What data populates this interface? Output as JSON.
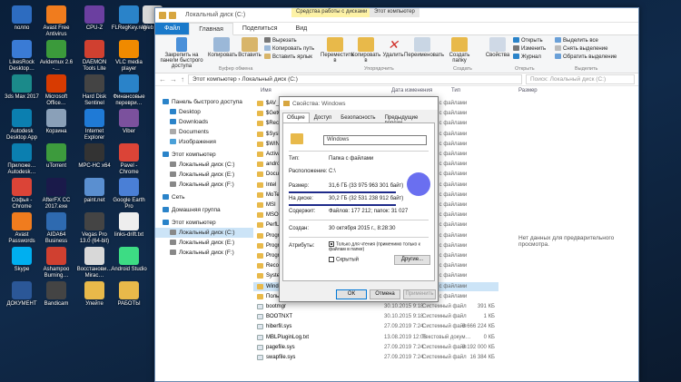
{
  "desktop_icons": [
    {
      "label": "nолпо",
      "color": "#2d6cc0"
    },
    {
      "label": "Avast Free Antivirus",
      "color": "#f07c1e"
    },
    {
      "label": "CPU-Z",
      "color": "#6b3fa0"
    },
    {
      "label": "FLRegKey.reg",
      "color": "#2a83c9"
    },
    {
      "label": "Web Ma",
      "color": "#d9d9d9"
    },
    {
      "label": "LikesRock Desktop…",
      "color": "#3a7bd5"
    },
    {
      "label": "Avidemux 2.6 -…",
      "color": "#3b9a3b"
    },
    {
      "label": "DAEMON Tools Lite",
      "color": "#d04030"
    },
    {
      "label": "VLC media player",
      "color": "#f08a00"
    },
    {
      "label": "3ds Max 2017",
      "color": "#1b8a8a"
    },
    {
      "label": "Microsoft Office…",
      "color": "#d83b01"
    },
    {
      "label": "Hard Disk Sentinel",
      "color": "#444"
    },
    {
      "label": "Финансовые переври…",
      "color": "#2a83c9"
    },
    {
      "label": "Autodesk Desktop App",
      "color": "#0b7fb0"
    },
    {
      "label": "Корзина",
      "color": "#8aa0b8"
    },
    {
      "label": "Internet Explorer",
      "color": "#1f7ad6"
    },
    {
      "label": "Viber",
      "color": "#7b519d"
    },
    {
      "label": "Приложе… Autodesk…",
      "color": "#0b7fb0"
    },
    {
      "label": "uTorrent",
      "color": "#3d9b3d"
    },
    {
      "label": "MPC-HC x64",
      "color": "#333"
    },
    {
      "label": "Pavel - Chrome",
      "color": "#db4437"
    },
    {
      "label": "Софья - Chrome",
      "color": "#db4437"
    },
    {
      "label": "AfterFX CC 2017.exe",
      "color": "#1a1a4a"
    },
    {
      "label": "paint.net",
      "color": "#5a8fd0"
    },
    {
      "label": "Google Earth Pro",
      "color": "#4a7fd6"
    },
    {
      "label": "Avast Passwords",
      "color": "#f07c1e"
    },
    {
      "label": "AIDA64 Business",
      "color": "#2e6ab0"
    },
    {
      "label": "Vegas Pro 13.0 (64-bit)",
      "color": "#444"
    },
    {
      "label": "links-drift.txt",
      "color": "#eee"
    },
    {
      "label": "Skype",
      "color": "#00aff0"
    },
    {
      "label": "Ashampoo Burning…",
      "color": "#d04030"
    },
    {
      "label": "Восстанови… Mirac…",
      "color": "#d8d8d8"
    },
    {
      "label": "Android Studio",
      "color": "#3ddc84"
    },
    {
      "label": "ДОКУМЕНТ",
      "color": "#2b5797"
    },
    {
      "label": "Bandicam",
      "color": "#444"
    },
    {
      "label": "Улейте",
      "color": "#e8b94a"
    },
    {
      "label": "РАБОТЫ",
      "color": "#e8b94a"
    }
  ],
  "explorer": {
    "title": "Локальный диск (C:)",
    "context_tabs": [
      "Средства работы с дисками",
      "Этот компьютер"
    ],
    "ribbon_tabs": [
      "Файл",
      "Главная",
      "Поделиться",
      "Вид"
    ],
    "ribbon": {
      "pin_label": "Закрепить на панели быстрого доступа",
      "copy_label": "Копировать",
      "paste_label": "Вставить",
      "cut_label": "Вырезать",
      "copy_path_label": "Копировать путь",
      "paste_shortcut_label": "Вставить ярлык",
      "clipboard_group": "Буфер обмена",
      "move_to_label": "Переместить в",
      "copy_to_label": "Копировать в",
      "delete_label": "Удалить",
      "rename_label": "Переименовать",
      "organize_group": "Упорядочить",
      "new_folder_label": "Создать папку",
      "create_group": "Создать",
      "properties_label": "Свойства",
      "open_label": "Открыть",
      "edit_label": "Изменить",
      "journal_label": "Журнал",
      "open_group": "Открыть",
      "select_all_label": "Выделить все",
      "select_none_label": "Снять выделение",
      "invert_label": "Обратить выделение",
      "select_group": "Выделить"
    },
    "address": {
      "path": "Этот компьютер  ›  Локальный диск (C:)",
      "search_placeholder": "Поиск: Локальный диск (C:)"
    },
    "columns": {
      "name": "Имя",
      "date": "Дата изменения",
      "type": "Тип",
      "size": "Размер"
    },
    "nav": [
      {
        "label": "Панель быстрого доступа",
        "color": "#2a83c9",
        "indent": 0
      },
      {
        "label": "Desktop",
        "color": "#2a83c9",
        "indent": 1
      },
      {
        "label": "Downloads",
        "color": "#2a83c9",
        "indent": 1
      },
      {
        "label": "Documents",
        "color": "#aaa",
        "indent": 1
      },
      {
        "label": "Изображения",
        "color": "#4aa0d8",
        "indent": 1
      },
      {
        "label": "Этот компьютер",
        "color": "#2a83c9",
        "indent": 0
      },
      {
        "label": "Локальный диск (C:)",
        "color": "#888",
        "indent": 1
      },
      {
        "label": "Локальный диск (E:)",
        "color": "#888",
        "indent": 1
      },
      {
        "label": "Локальный диск (F:)",
        "color": "#888",
        "indent": 1
      },
      {
        "label": "Сеть",
        "color": "#2a83c9",
        "indent": 0
      },
      {
        "label": "Домашняя группа",
        "color": "#2a83c9",
        "indent": 0
      },
      {
        "label": "Этот компьютер",
        "color": "#2a83c9",
        "indent": 0
      },
      {
        "label": "Локальный диск (C:)",
        "color": "#888",
        "indent": 1,
        "selected": true
      },
      {
        "label": "Локальный диск (E:)",
        "color": "#888",
        "indent": 1
      },
      {
        "label": "Локальный диск (F:)",
        "color": "#888",
        "indent": 1
      }
    ],
    "files": [
      {
        "name": "$AV_AS",
        "date": "",
        "type": "Папка с файлами",
        "size": ""
      },
      {
        "name": "$GetCu",
        "date": "",
        "type": "Папка с файлами",
        "size": ""
      },
      {
        "name": "$Recyc",
        "date": "",
        "type": "Папка с файлами",
        "size": ""
      },
      {
        "name": "$SysRe",
        "date": "",
        "type": "Папка с файлами",
        "size": ""
      },
      {
        "name": "$WIND",
        "date": "",
        "type": "Папка с файлами",
        "size": ""
      },
      {
        "name": "Activat",
        "date": "",
        "type": "Папка с файлами",
        "size": ""
      },
      {
        "name": "android",
        "date": "",
        "type": "Папка с файлами",
        "size": ""
      },
      {
        "name": "Docum",
        "date": "",
        "type": "Папка с файлами",
        "size": ""
      },
      {
        "name": "Intel",
        "date": "",
        "type": "Папка с файлами",
        "size": ""
      },
      {
        "name": "MoTem",
        "date": "",
        "type": "Папка с файлами",
        "size": ""
      },
      {
        "name": "MSI",
        "date": "",
        "type": "Папка с файлами",
        "size": ""
      },
      {
        "name": "MSOCa",
        "date": "",
        "type": "Папка с файлами",
        "size": ""
      },
      {
        "name": "PerfLog",
        "date": "",
        "type": "Папка с файлами",
        "size": ""
      },
      {
        "name": "Progra",
        "date": "",
        "type": "Папка с файлами",
        "size": ""
      },
      {
        "name": "Progra",
        "date": "",
        "type": "Папка с файлами",
        "size": ""
      },
      {
        "name": "Progra",
        "date": "",
        "type": "Папка с файлами",
        "size": ""
      },
      {
        "name": "Recover",
        "date": "",
        "type": "Папка с файлами",
        "size": ""
      },
      {
        "name": "System",
        "date": "",
        "type": "Папка с файлами",
        "size": ""
      },
      {
        "name": "Window",
        "date": "",
        "type": "Папка с файлами",
        "size": "",
        "selected": true
      },
      {
        "name": "Пользо",
        "date": "",
        "type": "Папка с файлами",
        "size": ""
      },
      {
        "name": "bootmgr",
        "date": "30.10.2015 9:18",
        "type": "Системный файл",
        "size": "391 КБ"
      },
      {
        "name": "BOOTNXT",
        "date": "30.10.2015 9:18",
        "type": "Системный файл",
        "size": "1 КБ"
      },
      {
        "name": "hiberfil.sys",
        "date": "27.09.2019 7:24",
        "type": "Системный файл",
        "size": "6 666 224 КБ"
      },
      {
        "name": "MBLPluginLog.txt",
        "date": "13.08.2019 12:06",
        "type": "Текстовый докум…",
        "size": "0 КБ"
      },
      {
        "name": "pagefile.sys",
        "date": "27.09.2019 7:24",
        "type": "Системный файл",
        "size": "8 192 000 КБ"
      },
      {
        "name": "swapfile.sys",
        "date": "27.09.2019 7:24",
        "type": "Системный файл",
        "size": "16 384 КБ"
      }
    ],
    "preview_text": "Нет данных для предварительного просмотра."
  },
  "dialog": {
    "title": "Свойства: Windows",
    "tabs": [
      "Общие",
      "Доступ",
      "Безопасность",
      "Предыдущие версии"
    ],
    "name": "Windows",
    "type_label": "Тип:",
    "type_value": "Папка с файлами",
    "location_label": "Расположение:",
    "location_value": "C:\\",
    "size_label": "Размер:",
    "size_value": "31,6 ГБ (33 975 963 301 байт)",
    "disk_label": "На диске:",
    "disk_value": "30,2 ГБ (32 531 238 912 байт)",
    "contains_label": "Содержит:",
    "contains_value": "Файлов: 177 212; папок: 31 027",
    "created_label": "Создан:",
    "created_value": "30 октября 2015 г., 8:28:30",
    "attributes_label": "Атрибуты:",
    "readonly_label": "Только для чтения (применимо только к файлам в папке)",
    "hidden_label": "Скрытый",
    "other_button": "Другие...",
    "ok_button": "ОК",
    "cancel_button": "Отмена",
    "apply_button": "Применить"
  }
}
